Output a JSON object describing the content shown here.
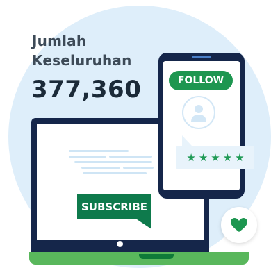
{
  "headline": {
    "line1": "Jumlah",
    "line2": "Keseluruhan"
  },
  "total": "377,360",
  "buttons": {
    "follow": "FOLLOW",
    "subscribe": "SUBSCRIBE"
  },
  "rating": {
    "stars": "★★★★★",
    "value": 5,
    "max": 5
  },
  "icons": {
    "profile": "user-icon",
    "heart": "heart-icon"
  },
  "colors": {
    "brand_green": "#1d9650",
    "dark_navy": "#15264a",
    "accent_green": "#59b75c",
    "background": "#deeefa"
  }
}
